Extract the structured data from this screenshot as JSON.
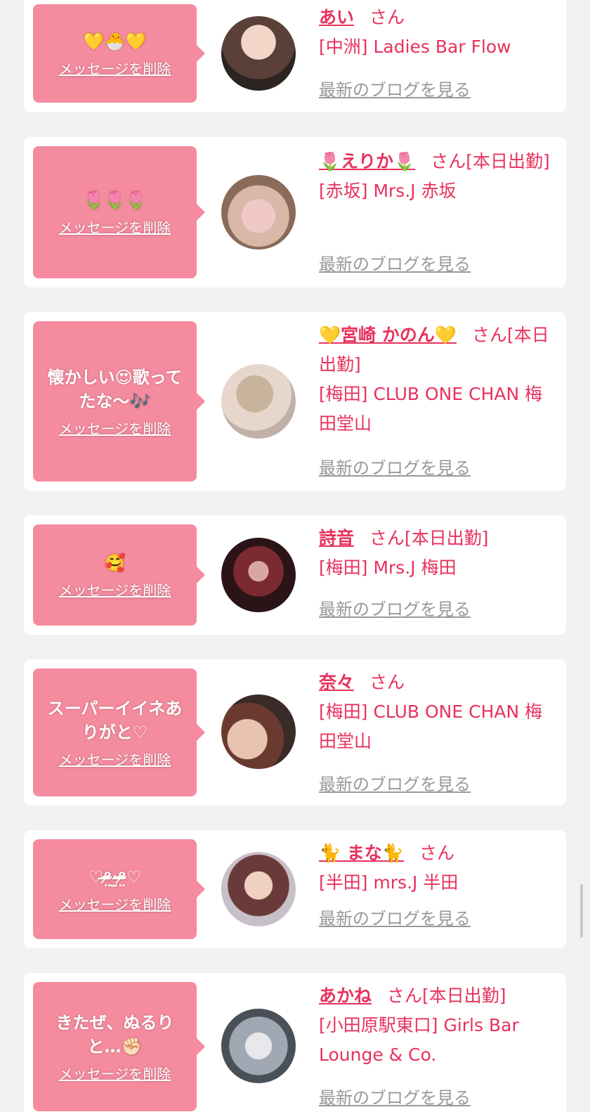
{
  "delete_label": "メッセージを削除",
  "blog_label": "最新のブログを見る",
  "san_suffix": "さん",
  "colors": {
    "accent": "#e8315c",
    "bubble": "#f58b9e",
    "link_gray": "#999999",
    "page_bg": "#f2f2f2"
  },
  "cards": [
    {
      "message": "💛🐣💛",
      "name": "あい",
      "status": "",
      "shop": "[中洲] Ladies Bar Flow"
    },
    {
      "message": "🌷🌷🌷",
      "name": "🌷えりか🌷",
      "status": "[本日出勤]",
      "shop": "[赤坂] Mrs.J 赤坂"
    },
    {
      "message": "懐かしい😍歌ってたな〜🎶",
      "name": "💛宮崎 かのん💛",
      "status": "[本日出勤]",
      "shop": "[梅田] CLUB ONE CHAN 梅田堂山"
    },
    {
      "message": "🥰",
      "name": "詩音",
      "status": "[本日出勤]",
      "shop": "[梅田] Mrs.J 梅田"
    },
    {
      "message": "スーパーイイネありがと♡",
      "name": "奈々",
      "status": "",
      "shop": "[梅田] CLUB ONE CHAN 梅田堂山"
    },
    {
      "message": "♡ᵒ̴̶̷̤·̫ᵒ̴̶̷̤♡",
      "name": "🐈 まな🐈",
      "status": "",
      "shop": "[半田] mrs.J 半田"
    },
    {
      "message": "きたぜ、ぬるりと…✊🏻",
      "name": "あかね",
      "status": "[本日出勤]",
      "shop": "[小田原駅東口] Girls Bar Lounge & Co."
    }
  ]
}
